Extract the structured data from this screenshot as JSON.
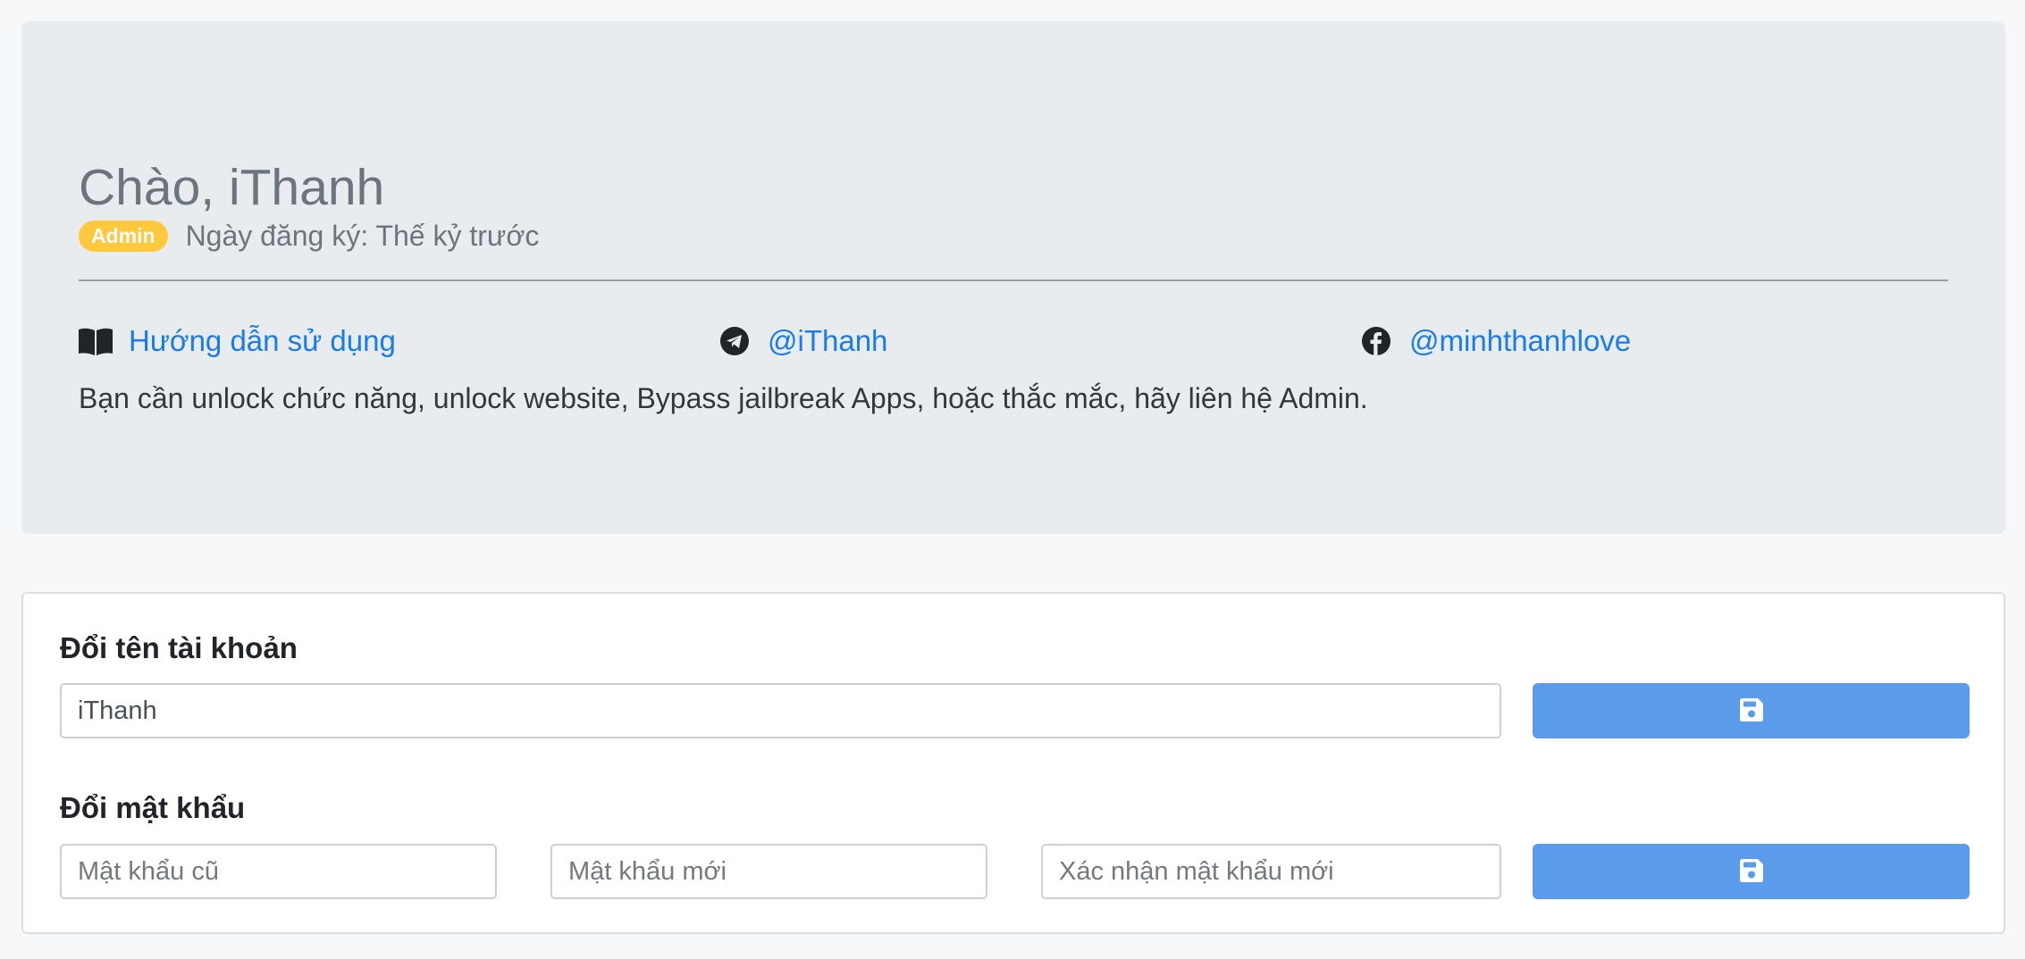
{
  "header": {
    "greeting": "Chào, iThanh",
    "role_badge": "Admin",
    "registration": "Ngày đăng ký: Thế kỷ trước"
  },
  "links": [
    {
      "icon": "book-icon",
      "label": "Hướng dẫn sử dụng"
    },
    {
      "icon": "telegram-icon",
      "label": "@iThanh"
    },
    {
      "icon": "facebook-icon",
      "label": "@minhthanhlove"
    }
  ],
  "notice": "Bạn cần unlock chức năng, unlock website, Bypass jailbreak Apps, hoặc thắc mắc, hãy liên hệ Admin.",
  "rename": {
    "title": "Đổi tên tài khoản",
    "value": "iThanh",
    "save_icon": "floppy-disk-icon"
  },
  "password": {
    "title": "Đổi mật khẩu",
    "old_placeholder": "Mật khẩu cũ",
    "new_placeholder": "Mật khẩu mới",
    "confirm_placeholder": "Xác nhận mật khẩu mới",
    "save_icon": "floppy-disk-icon"
  },
  "colors": {
    "badge": "#ffc83d",
    "link": "#1a7ce8",
    "button": "#5a9bea",
    "jumbotron_bg": "#e9ecef"
  }
}
